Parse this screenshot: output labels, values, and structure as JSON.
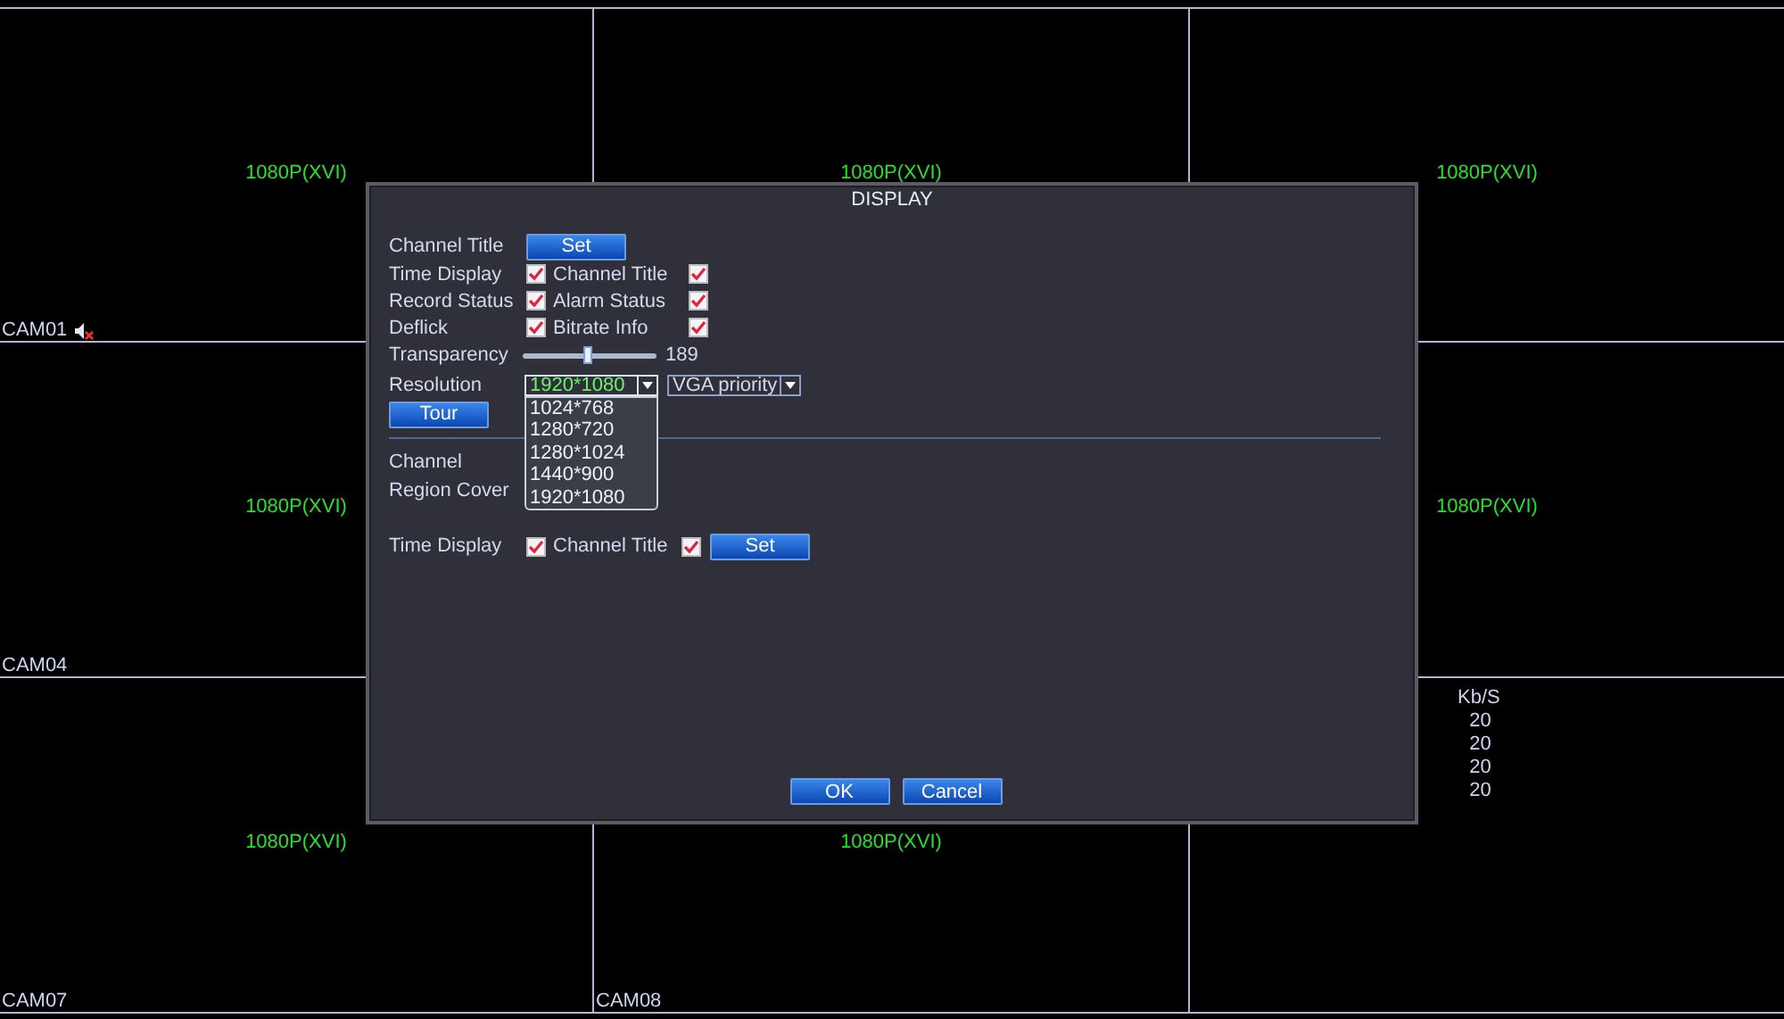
{
  "camera_grid": [
    {
      "left": {
        "format": "1080P(XVI)",
        "camera": "CAM01",
        "muted": true
      },
      "center": {
        "format": "1080P(XVI)"
      },
      "right": {
        "format": "1080P(XVI)"
      }
    },
    {
      "left": {
        "format": "1080P(XVI)",
        "camera": "CAM04"
      },
      "right": {
        "format": "1080P(XVI)"
      }
    },
    {
      "left": {
        "format": "1080P(XVI)",
        "camera": "CAM07"
      },
      "center": {
        "format": "1080P(XVI)",
        "camera": "CAM08"
      },
      "right": {
        "stats": {
          "unit": "Kb/S",
          "values": [
            "20",
            "20",
            "20",
            "20"
          ]
        }
      }
    }
  ],
  "dialog": {
    "title": "DISPLAY",
    "channel_title": {
      "label": "Channel Title",
      "button": "Set"
    },
    "checks": [
      [
        {
          "label": "Time Display",
          "checked": true
        },
        {
          "label": "Channel Title",
          "checked": true
        }
      ],
      [
        {
          "label": "Record Status",
          "checked": true
        },
        {
          "label": "Alarm Status",
          "checked": true
        }
      ],
      [
        {
          "label": "Deflick",
          "checked": true
        },
        {
          "label": "Bitrate Info",
          "checked": true
        }
      ]
    ],
    "transparency": {
      "label": "Transparency",
      "level": 0.49,
      "reading": "189"
    },
    "resolution": {
      "label": "Resolution",
      "value": "1920*1080",
      "expanded": true,
      "options": [
        "1024*768",
        "1280*720",
        "1280*1024",
        "1440*900",
        "1920*1080"
      ],
      "priority": "VGA priority"
    },
    "tour_button": "Tour",
    "channel_label": "Channel",
    "region_cover_label": "Region Cover",
    "bottom_checks": [
      {
        "label": "Time Display",
        "checked": true
      },
      {
        "label": "Channel Title",
        "checked": true
      }
    ],
    "bottom_button": "Set",
    "buttons": [
      "OK",
      "Cancel"
    ]
  }
}
